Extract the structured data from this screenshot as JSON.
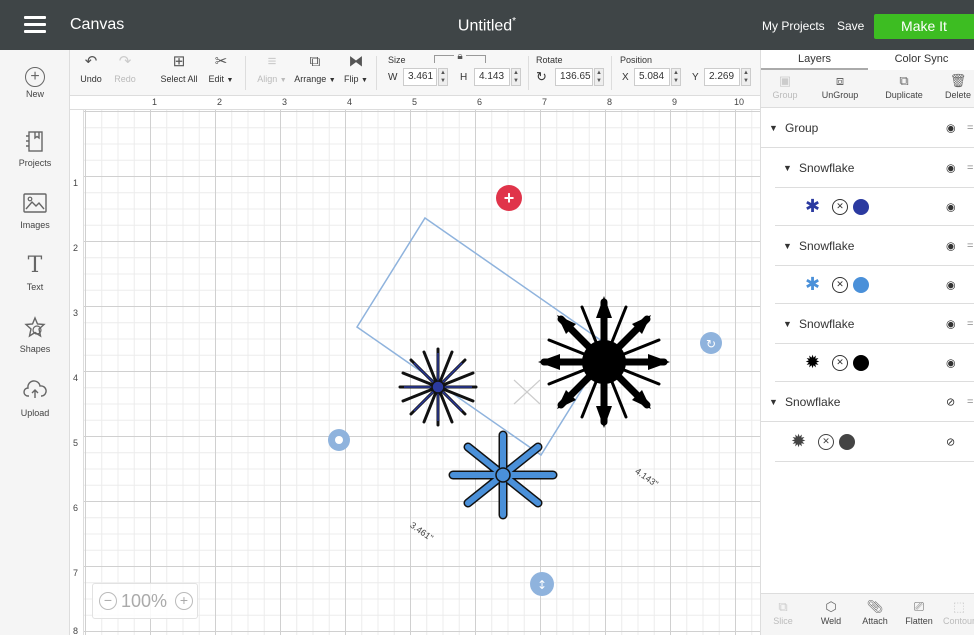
{
  "header": {
    "menu_icon": "hamburger-menu-icon",
    "brand": "Canvas",
    "doc_title": "Untitled",
    "unsaved_marker": "*",
    "my_projects": "My Projects",
    "save": "Save",
    "make_it": "Make It",
    "make_it_color": "#3dbd22"
  },
  "toolbar": {
    "undo": "Undo",
    "redo": "Redo",
    "select_all": "Select All",
    "edit": "Edit",
    "align": "Align",
    "arrange": "Arrange",
    "flip": "Flip",
    "size_label": "Size",
    "w_label": "W",
    "w_value": "3.461",
    "h_label": "H",
    "h_value": "4.143",
    "rotate_label": "Rotate",
    "rotate_value": "136.65",
    "position_label": "Position",
    "x_label": "X",
    "x_value": "5.084",
    "y_label": "Y",
    "y_value": "2.269"
  },
  "sidebar": {
    "items": [
      {
        "label": "New",
        "icon": "plus-circle-icon"
      },
      {
        "label": "Projects",
        "icon": "projects-icon"
      },
      {
        "label": "Images",
        "icon": "image-icon"
      },
      {
        "label": "Text",
        "icon": "text-icon"
      },
      {
        "label": "Shapes",
        "icon": "shapes-icon"
      },
      {
        "label": "Upload",
        "icon": "upload-cloud-icon"
      }
    ]
  },
  "rulers": {
    "top": [
      "1",
      "2",
      "3",
      "4",
      "5",
      "6",
      "7",
      "8",
      "9",
      "10"
    ],
    "left": [
      "1",
      "2",
      "3",
      "4",
      "5",
      "6",
      "7",
      "8"
    ]
  },
  "canvas": {
    "selection_width_label": "3.461\"",
    "selection_height_label": "4.143\"",
    "selection_color": "#8fb3dd",
    "delete_handle_color": "#e0344a",
    "snowflake_colors": [
      "#2b3aa0",
      "#4a90d9",
      "#000000"
    ]
  },
  "zoom": {
    "value": "100%",
    "minus": "−",
    "plus": "+"
  },
  "layers_panel": {
    "tabs": [
      "Layers",
      "Color Sync"
    ],
    "actions": [
      "Group",
      "UnGroup",
      "Duplicate",
      "Delete"
    ],
    "rows": [
      {
        "type": "group",
        "label": "Group"
      },
      {
        "type": "group",
        "label": "Snowflake"
      },
      {
        "type": "item",
        "color": "#2b3aa0"
      },
      {
        "type": "group",
        "label": "Snowflake"
      },
      {
        "type": "item",
        "color": "#4a90d9"
      },
      {
        "type": "group",
        "label": "Snowflake"
      },
      {
        "type": "item",
        "color": "#000000"
      },
      {
        "type": "group",
        "label": "Snowflake",
        "hidden": true
      },
      {
        "type": "item",
        "color": "#444444",
        "hidden": true
      }
    ],
    "bottom_actions": [
      "Slice",
      "Weld",
      "Attach",
      "Flatten",
      "Contour"
    ]
  }
}
